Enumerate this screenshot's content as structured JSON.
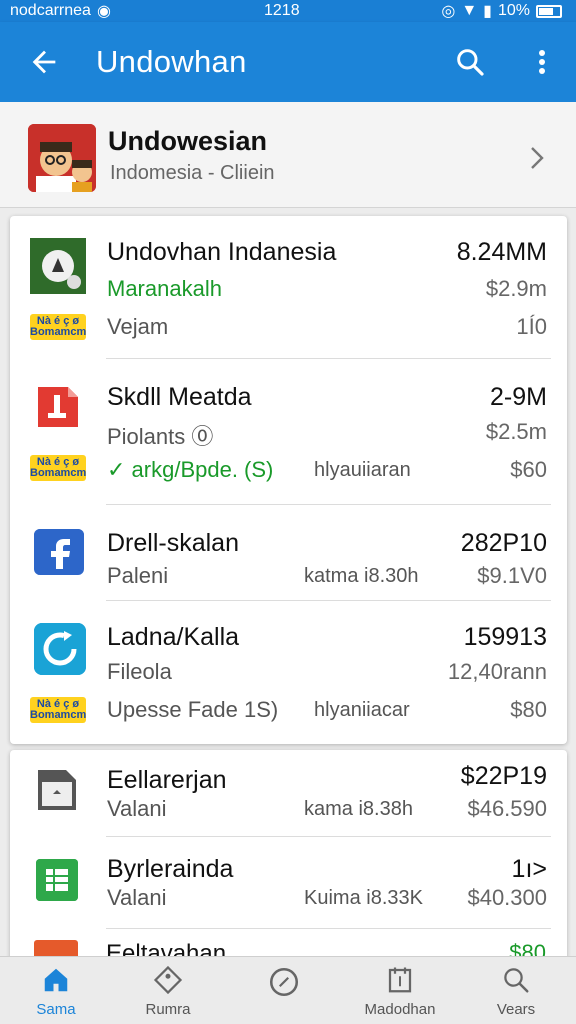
{
  "status_bar": {
    "left_text": "nodcarrnea",
    "time": "1218",
    "battery": "10%"
  },
  "app_bar": {
    "title": "Undowhan"
  },
  "profile": {
    "title": "Undowesian",
    "subtitle": "Indomesia - Cliiein"
  },
  "items": [
    {
      "title": "Undovhan Indanesia",
      "subtitle": "Maranakalh",
      "subtitle_color": "green",
      "right_value": "8.24MM",
      "right_sub": "$2.9m",
      "line3_left": "Vejam",
      "line3_right": "1Í0",
      "badge": "Nà é ç ø\nBomamcm"
    },
    {
      "title": "Skdll Meatda",
      "subtitle": "Piolants ⓪",
      "right_value": "2-9M",
      "right_sub": "$2.5m",
      "line3_left": "✓ arkg/Bpde. (S)",
      "line3_mid": "hlyauiiaran",
      "line3_right": "$60",
      "badge": "Nà é ç ø\nBomamcm"
    },
    {
      "title": "Drell-skalan",
      "subtitle": "Paleni",
      "mid": "katma i8.30h",
      "right_value": "282P10",
      "right_sub": "$9.1V0"
    },
    {
      "title": "Ladna/Kalla",
      "subtitle": "Fileola",
      "right_value": "159913",
      "right_sub": "12,40rann",
      "line3_left": "Upesse Fade 1S)",
      "line3_mid": "hlyaniiacar",
      "line3_right": "$80",
      "badge": "Nà é ç ø\nBomamcm"
    }
  ],
  "items2": [
    {
      "title": "Eellarerjan",
      "subtitle": "Valani",
      "mid": "kama i8.38h",
      "right_value": "$22P19",
      "right_sub": "$46.590"
    },
    {
      "title": "Byrlerainda",
      "subtitle": "Valani",
      "mid": "Kuima i8.33K",
      "right_value": "1ı>",
      "right_sub": "$40.300"
    }
  ],
  "peek": {
    "title": "Eeltavahan",
    "right": "$80"
  },
  "bottom_nav": [
    {
      "label": "Sama",
      "icon": "home-icon"
    },
    {
      "label": "Rumra",
      "icon": "tag-icon"
    },
    {
      "label": "",
      "icon": "compass-icon"
    },
    {
      "label": "Madodhan",
      "icon": "calendar-icon"
    },
    {
      "label": "Vears",
      "icon": "search-icon"
    }
  ],
  "colors": {
    "primary": "#1c84d8",
    "green": "#1a9a2a",
    "badge": "#ffd21f"
  }
}
